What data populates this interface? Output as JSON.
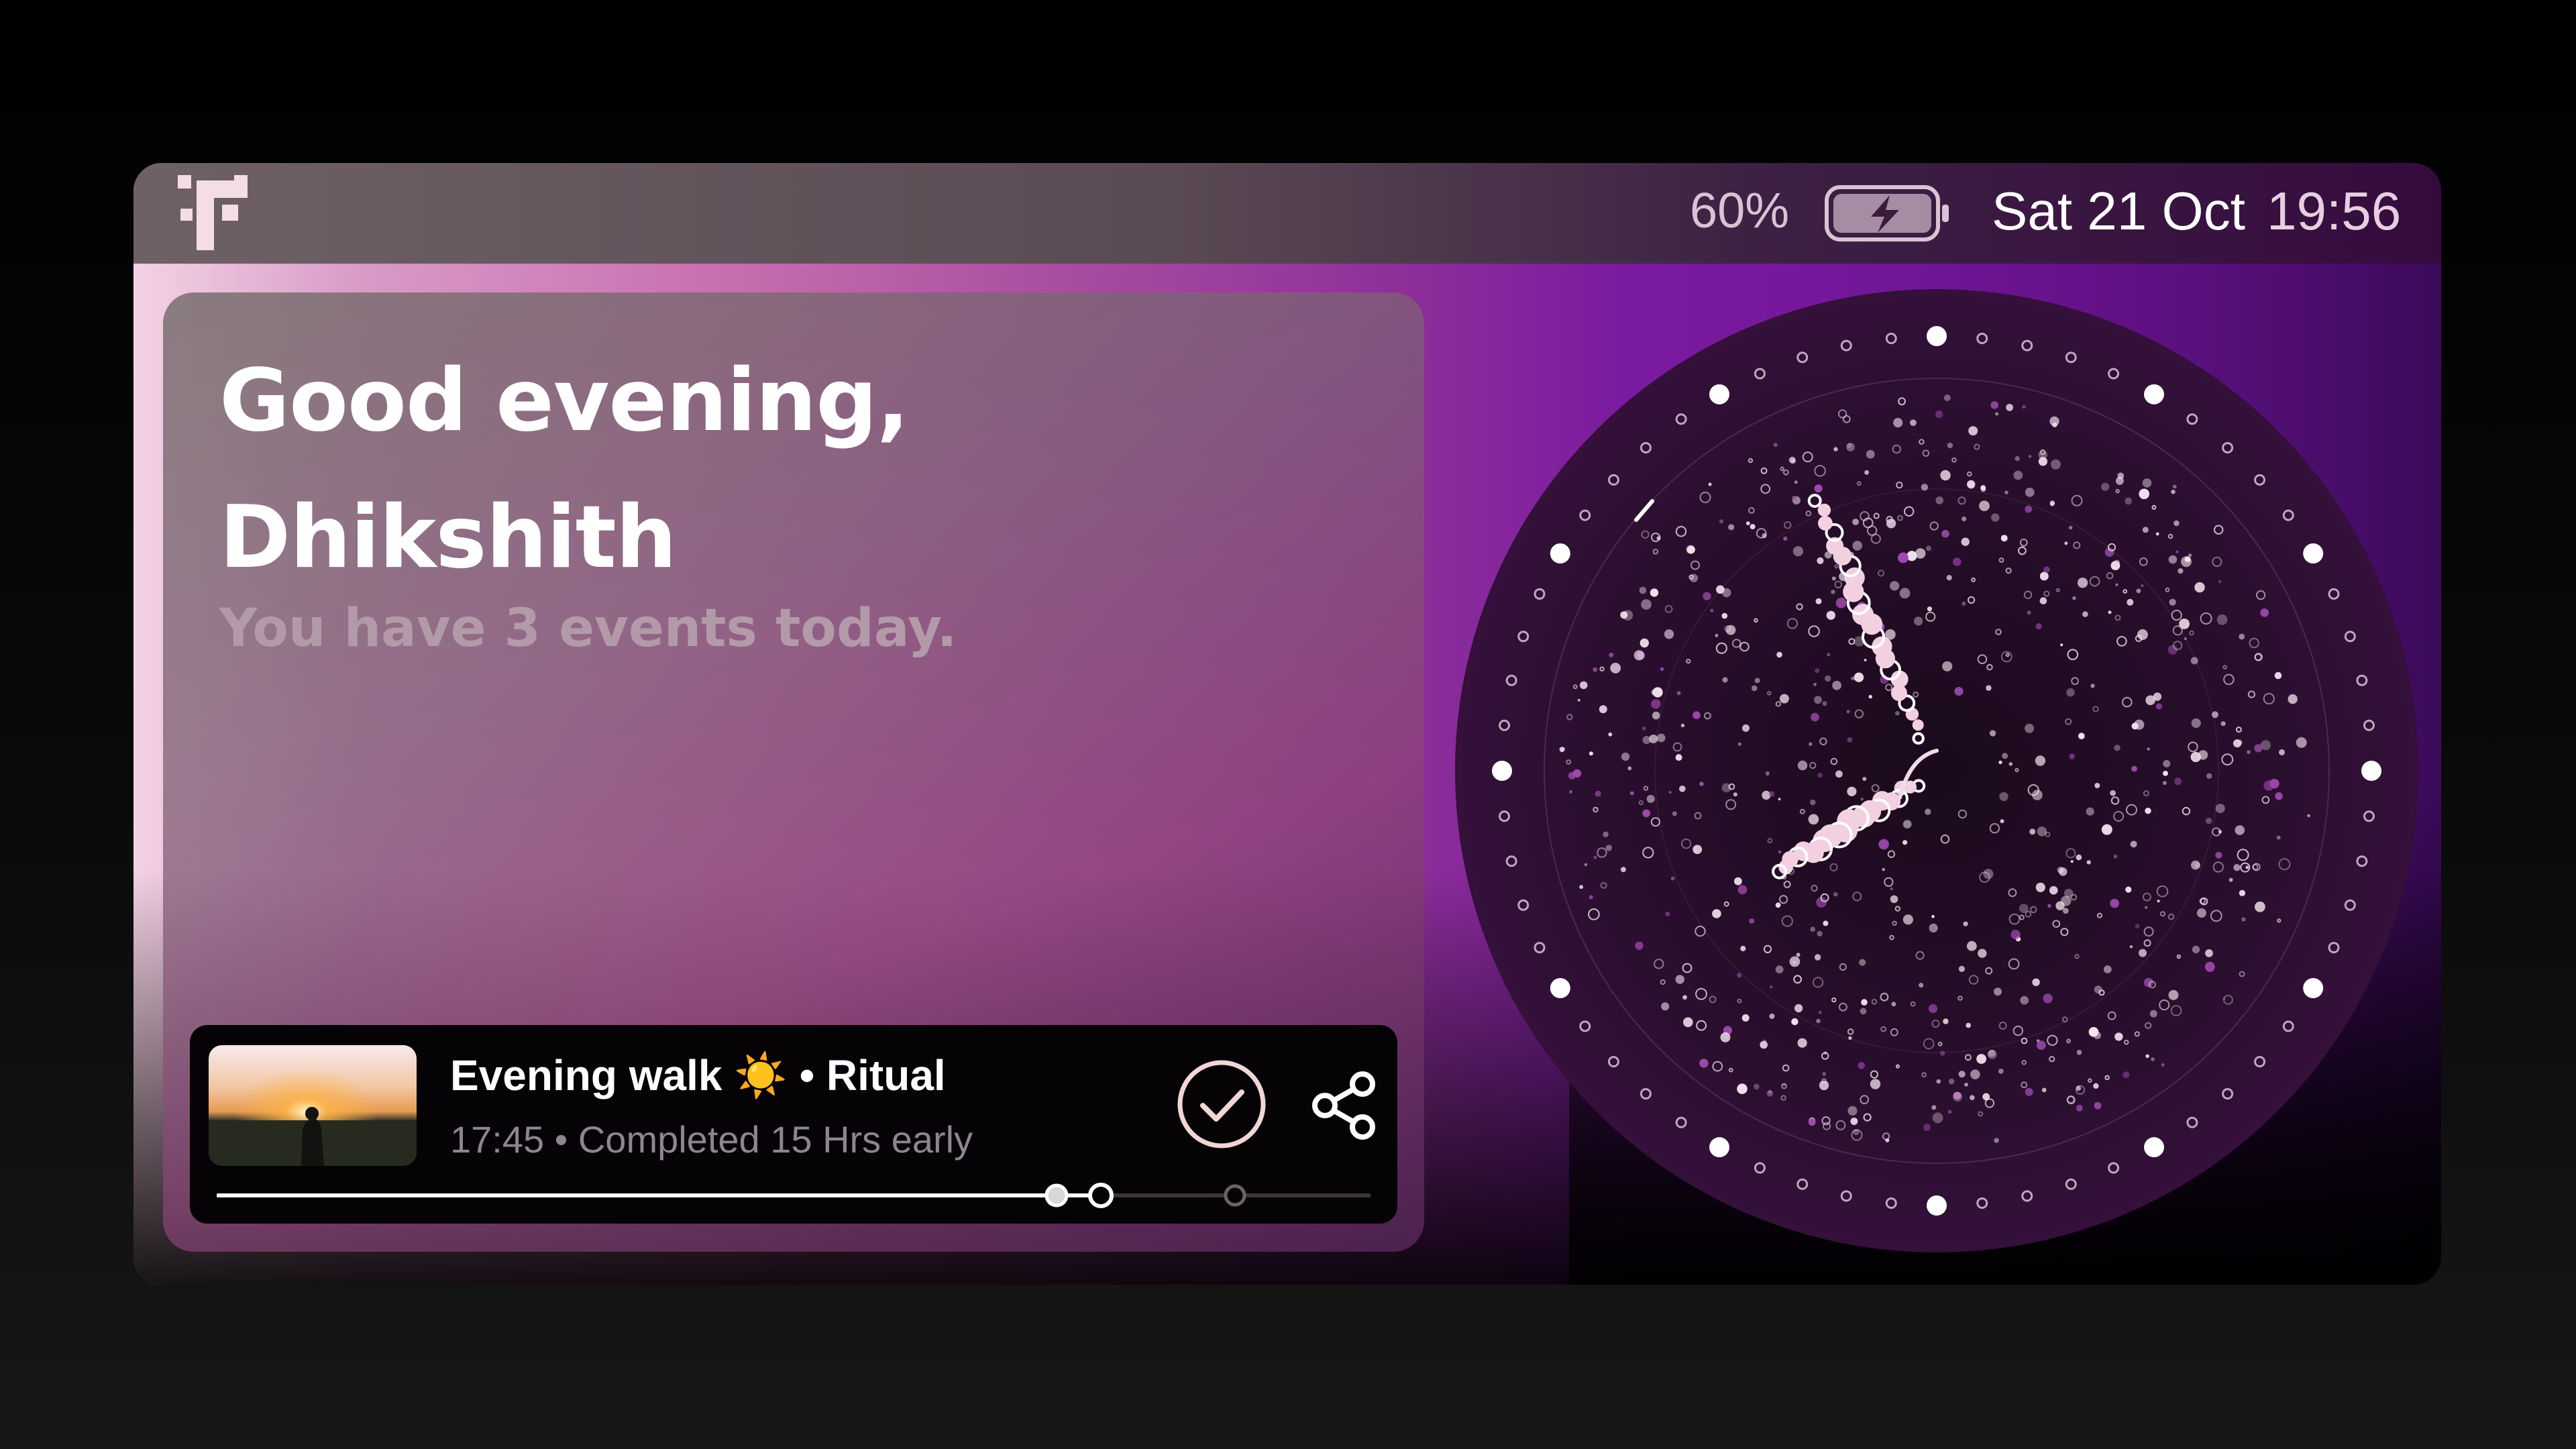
{
  "status_bar": {
    "logo_icon": "pixel-t-logo-icon",
    "battery_percent": "60%",
    "battery_icon": "battery-charging-icon",
    "date": "Sat 21 Oct",
    "time": "19:56"
  },
  "greeting": {
    "title_line1": "Good evening,",
    "title_line2": "Dhikshith",
    "subtitle": "You have 3 events today."
  },
  "event": {
    "title_name": "Evening walk",
    "title_emoji": "☀️",
    "title_separator": " • ",
    "title_type": "Ritual",
    "meta": "17:45 • Completed 15 Hrs early",
    "check_icon": "check-circle-icon",
    "share_icon": "share-icon",
    "timeline_progress": 0.73
  },
  "clock": {
    "hour": 19,
    "minute": 56,
    "colors": {
      "accent": "#f2d0e0",
      "dot": "#ffffff",
      "purple_dot": "#a04ab0"
    }
  },
  "colors": {
    "statusbar_left": "#6e6166",
    "statusbar_right": "#350b3e",
    "event_card_bg": "#050305",
    "sun": "#ffc324"
  }
}
